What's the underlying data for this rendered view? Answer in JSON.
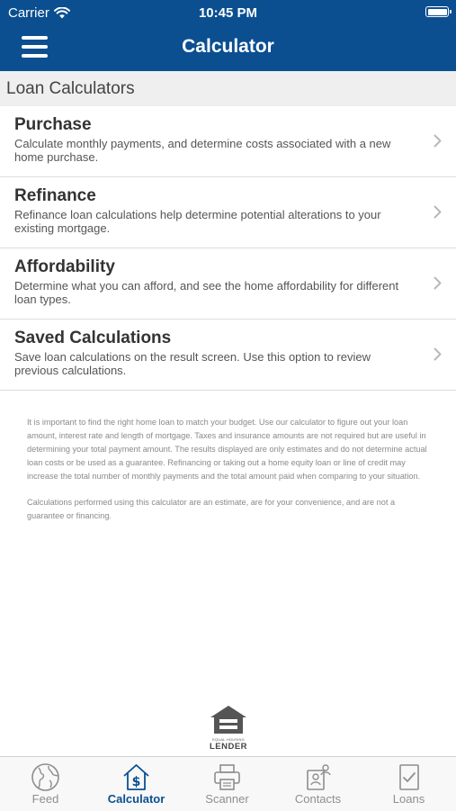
{
  "status_bar": {
    "carrier": "Carrier",
    "time": "10:45 PM"
  },
  "header": {
    "title": "Calculator",
    "menu_icon": "hamburger-menu-icon"
  },
  "section": {
    "title": "Loan Calculators"
  },
  "calculators": [
    {
      "title": "Purchase",
      "description": "Calculate monthly payments, and determine costs associated with a new home purchase."
    },
    {
      "title": "Refinance",
      "description": "Refinance loan calculations help determine potential alterations to your existing mortgage."
    },
    {
      "title": "Affordability",
      "description": "Determine what you can afford, and see the home affordability for different loan types."
    },
    {
      "title": "Saved Calculations",
      "description": "Save loan calculations on the result screen. Use this option to review previous calculations."
    }
  ],
  "disclaimer": {
    "p1": "It is important to find the right home loan to match your budget. Use our calculator to figure out your loan amount, interest rate and length of mortgage. Taxes and insurance amounts are not required but are useful in determining your total payment amount. The results displayed are only estimates and do not determine actual loan costs or be used as a guarantee. Refinancing or taking out a home equity loan or line of credit may increase the total number of monthly payments and the total amount paid when comparing to your situation.",
    "p2": "Calculations performed using this calculator are an estimate, are for your convenience, and are not a guarantee or financing."
  },
  "equal_housing_logo": {
    "small": "EQUAL HOUSING",
    "big": "LENDER"
  },
  "tabs": [
    {
      "label": "Feed",
      "icon": "globe-icon",
      "active": false
    },
    {
      "label": "Calculator",
      "icon": "house-dollar-icon",
      "active": true
    },
    {
      "label": "Scanner",
      "icon": "printer-scanner-icon",
      "active": false
    },
    {
      "label": "Contacts",
      "icon": "contacts-icon",
      "active": false
    },
    {
      "label": "Loans",
      "icon": "document-check-icon",
      "active": false
    }
  ],
  "colors": {
    "brand": "#0b4f91",
    "section_bg": "#efefef",
    "tab_inactive": "#8e8e8e"
  }
}
